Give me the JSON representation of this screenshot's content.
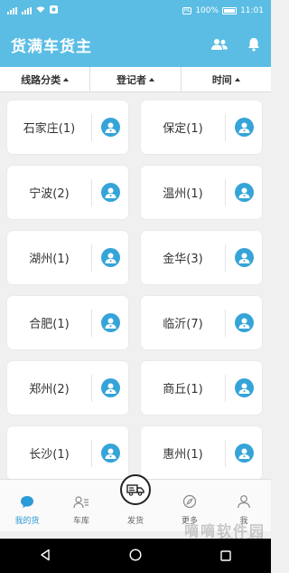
{
  "status_bar": {
    "battery": "100%",
    "time": "11:01",
    "hd": "HD"
  },
  "app_bar": {
    "title": "货满车货主"
  },
  "filters": [
    {
      "label": "线路分类"
    },
    {
      "label": "登记者"
    },
    {
      "label": "时间"
    }
  ],
  "cards": [
    {
      "city": "石家庄(1)"
    },
    {
      "city": "保定(1)"
    },
    {
      "city": "宁波(2)"
    },
    {
      "city": "温州(1)"
    },
    {
      "city": "湖州(1)"
    },
    {
      "city": "金华(3)"
    },
    {
      "city": "合肥(1)"
    },
    {
      "city": "临沂(7)"
    },
    {
      "city": "郑州(2)"
    },
    {
      "city": "商丘(1)"
    },
    {
      "city": "长沙(1)"
    },
    {
      "city": "惠州(1)"
    }
  ],
  "tabs": [
    {
      "label": "我的货",
      "icon": "chat-icon"
    },
    {
      "label": "车库",
      "icon": "garage-icon"
    },
    {
      "label": "发货",
      "icon": "truck-icon"
    },
    {
      "label": "更多",
      "icon": "compass-icon"
    },
    {
      "label": "我",
      "icon": "person-icon"
    }
  ],
  "watermark": {
    "text": "嘀嘀软件园",
    "url": "ddooo.com"
  },
  "colors": {
    "primary": "#5bbde3",
    "accent": "#35a4d8",
    "active_tab": "#2a9bd6"
  }
}
